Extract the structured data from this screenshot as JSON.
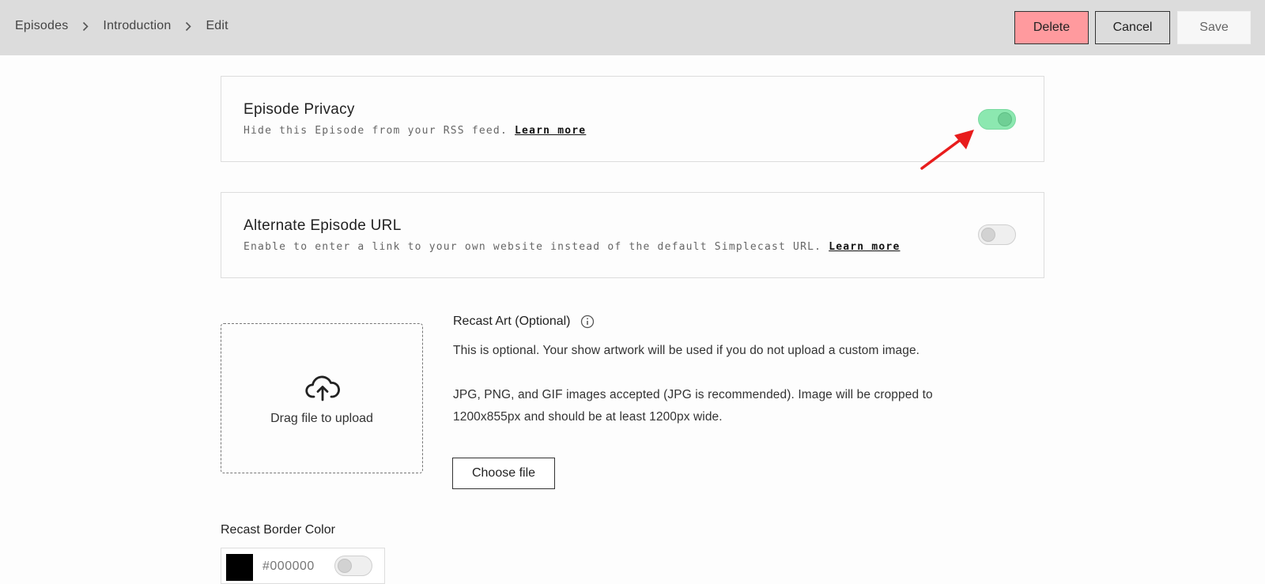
{
  "breadcrumb": {
    "items": [
      "Episodes",
      "Introduction",
      "Edit"
    ]
  },
  "actions": {
    "delete": "Delete",
    "cancel": "Cancel",
    "save": "Save"
  },
  "privacy": {
    "title": "Episode Privacy",
    "description": "Hide this Episode from your RSS feed.",
    "link": "Learn more",
    "enabled": true
  },
  "alternate_url": {
    "title": "Alternate Episode URL",
    "description": "Enable to enter a link to your own website instead of the default Simplecast URL.",
    "link": "Learn more",
    "enabled": false
  },
  "recast_art": {
    "upload_label": "Drag file to upload",
    "title": "Recast Art (Optional)",
    "text1": "This is optional. Your show artwork will be used if you do not upload a custom image.",
    "text2_line1": "JPG, PNG, and GIF images accepted (JPG is recommended). Image will be cropped to",
    "text2_line2": "1200x855px and should be at least 1200px wide.",
    "choose_button": "Choose file"
  },
  "border_color": {
    "label": "Recast Border Color",
    "value": "#000000",
    "swatch": "#000000",
    "enabled": false
  },
  "colors": {
    "accent_on": "#8ce8b0",
    "delete_bg": "#ff9a9e",
    "annotation_arrow": "#e81c1c"
  },
  "icons": {
    "breadcrumb_separator": "chevron-right-icon",
    "upload": "cloud-upload-icon",
    "info": "info-icon",
    "annotation": "red-arrow-annotation"
  }
}
